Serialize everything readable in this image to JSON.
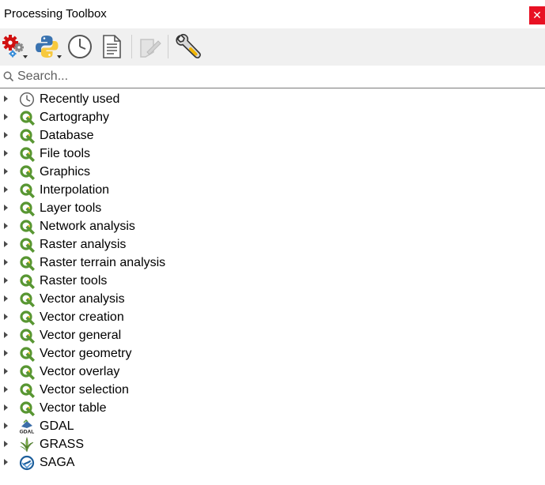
{
  "window": {
    "title": "Processing Toolbox",
    "close_label": "✕"
  },
  "toolbar": {
    "buttons": [
      {
        "name": "models-button",
        "icon": "gears-icon"
      },
      {
        "name": "scripts-button",
        "icon": "python-icon"
      },
      {
        "name": "history-button",
        "icon": "clock-icon"
      },
      {
        "name": "results-viewer-button",
        "icon": "document-icon"
      },
      {
        "name": "edit-features-in-place-button",
        "icon": "edit-in-place-icon",
        "disabled": true
      },
      {
        "name": "options-button",
        "icon": "wrench-icon"
      }
    ]
  },
  "search": {
    "placeholder": "Search..."
  },
  "tree": {
    "items": [
      {
        "label": "Recently used",
        "icon": "clock-icon"
      },
      {
        "label": "Cartography",
        "icon": "qgis-icon"
      },
      {
        "label": "Database",
        "icon": "qgis-icon"
      },
      {
        "label": "File tools",
        "icon": "qgis-icon"
      },
      {
        "label": "Graphics",
        "icon": "qgis-icon"
      },
      {
        "label": "Interpolation",
        "icon": "qgis-icon"
      },
      {
        "label": "Layer tools",
        "icon": "qgis-icon"
      },
      {
        "label": "Network analysis",
        "icon": "qgis-icon"
      },
      {
        "label": "Raster analysis",
        "icon": "qgis-icon"
      },
      {
        "label": "Raster terrain analysis",
        "icon": "qgis-icon"
      },
      {
        "label": "Raster tools",
        "icon": "qgis-icon"
      },
      {
        "label": "Vector analysis",
        "icon": "qgis-icon"
      },
      {
        "label": "Vector creation",
        "icon": "qgis-icon"
      },
      {
        "label": "Vector general",
        "icon": "qgis-icon"
      },
      {
        "label": "Vector geometry",
        "icon": "qgis-icon"
      },
      {
        "label": "Vector overlay",
        "icon": "qgis-icon"
      },
      {
        "label": "Vector selection",
        "icon": "qgis-icon"
      },
      {
        "label": "Vector table",
        "icon": "qgis-icon"
      },
      {
        "label": "GDAL",
        "icon": "gdal-icon"
      },
      {
        "label": "GRASS",
        "icon": "grass-icon"
      },
      {
        "label": "SAGA",
        "icon": "saga-icon"
      }
    ]
  },
  "colors": {
    "qgis_green": "#589632",
    "qgis_yellow": "#ee7913",
    "close_red": "#e81123",
    "toolbar_bg": "#f0f0f0"
  }
}
